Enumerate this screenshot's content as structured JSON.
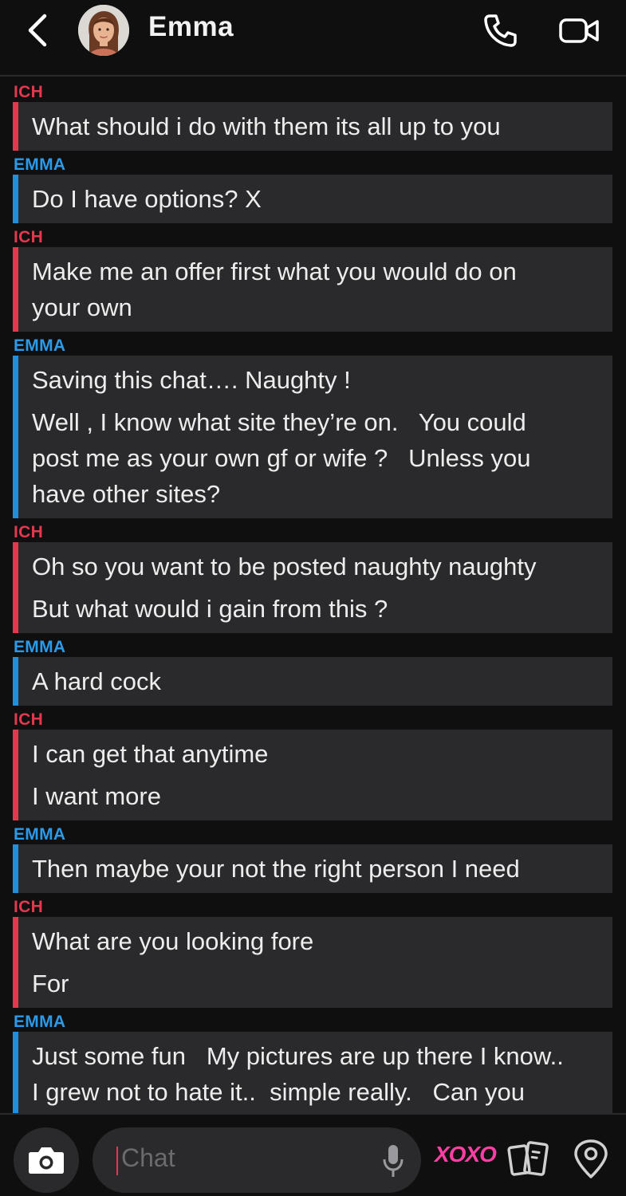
{
  "header": {
    "contact_name": "Emma",
    "icons": [
      "back-chevron-icon",
      "avatar-icon",
      "phone-icon",
      "video-camera-icon"
    ]
  },
  "messages": [
    {
      "sender": "ICH",
      "from": "me",
      "lines": [
        "What should i do with them its all up to you"
      ]
    },
    {
      "sender": "EMMA",
      "from": "them",
      "lines": [
        "Do I have options? X"
      ]
    },
    {
      "sender": "ICH",
      "from": "me",
      "lines": [
        "Make me an offer first what you would do on\nyour own"
      ]
    },
    {
      "sender": "EMMA",
      "from": "them",
      "lines": [
        "Saving this chat…. Naughty !",
        "Well , I know what site they’re on.   You could\npost me as your own gf or wife ?   Unless you\nhave other sites?"
      ]
    },
    {
      "sender": "ICH",
      "from": "me",
      "lines": [
        "Oh so you want to be posted naughty naughty",
        "But what would i gain from this ?"
      ]
    },
    {
      "sender": "EMMA",
      "from": "them",
      "lines": [
        "A hard cock"
      ]
    },
    {
      "sender": "ICH",
      "from": "me",
      "lines": [
        "I can get that anytime",
        "I want more"
      ]
    },
    {
      "sender": "EMMA",
      "from": "them",
      "lines": [
        "Then maybe your not the right person I need"
      ]
    },
    {
      "sender": "ICH",
      "from": "me",
      "lines": [
        "What are you looking fore",
        "For"
      ]
    },
    {
      "sender": "EMMA",
      "from": "them",
      "lines": [
        "Just some fun   My pictures are up there I know..\nI grew not to hate it..  simple really.   Can you"
      ]
    }
  ],
  "composer": {
    "placeholder": "Chat",
    "xoxo_label": "XOXO",
    "icons": [
      "camera-icon",
      "microphone-icon",
      "cards-icon",
      "location-pin-icon"
    ]
  },
  "colors": {
    "me_accent": "#e5384f",
    "them_accent": "#1f8fe0",
    "bubble_bg": "#2a2a2c",
    "background": "#0f0f10",
    "xoxo": "#ff3fa4"
  }
}
